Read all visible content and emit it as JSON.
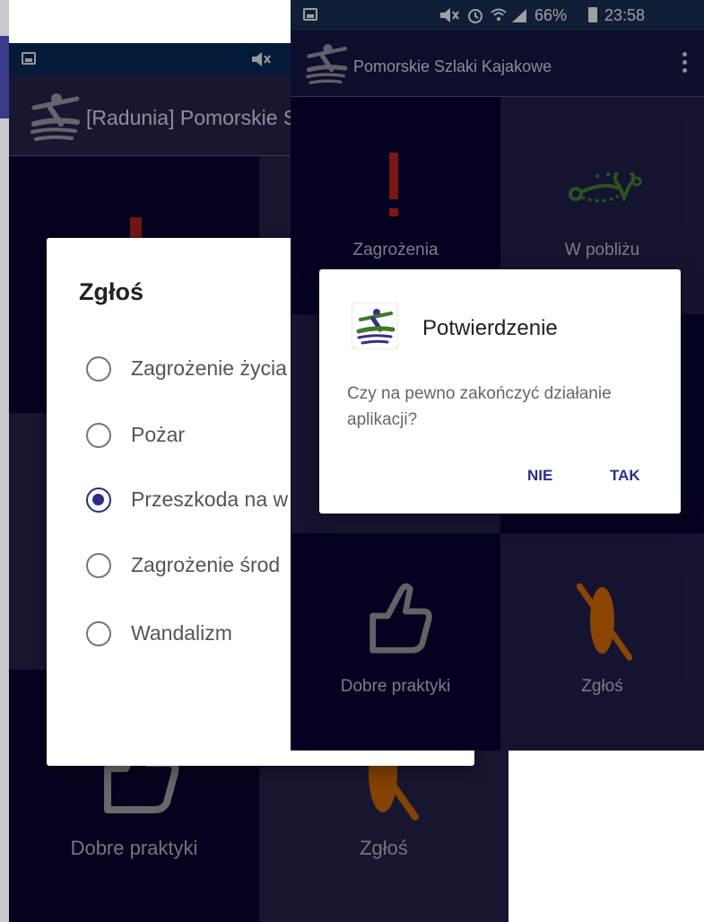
{
  "status_bar": {
    "battery_percent": "66%",
    "time": "23:58"
  },
  "left_screen": {
    "app_title": "[Radunia] Pomorskie S",
    "tiles": {
      "dobre_praktyki": "Dobre praktyki",
      "zglos": "Zgłoś"
    },
    "report_dialog": {
      "title": "Zgłoś",
      "selected_index": 2,
      "options": [
        "Zagrożenie życia",
        "Pożar",
        "Przeszkoda na w",
        "Zagrożenie środ",
        "Wandalizm"
      ]
    }
  },
  "right_screen": {
    "app_title": "Pomorskie Szlaki Kajakowe",
    "tiles": {
      "zagrozenia": "Zagrożenia",
      "w_poblizu": "W pobliżu",
      "dobre_praktyki": "Dobre praktyki",
      "zglos": "Zgłoś"
    },
    "confirm_dialog": {
      "title": "Potwierdzenie",
      "message": "Czy na pewno zakończyć działanie aplikacji?",
      "no_label": "NIE",
      "yes_label": "TAK"
    }
  },
  "colors": {
    "accent": "#2b2c8e",
    "danger_icon": "#b0201a",
    "nearby_icon": "#3c7a2a",
    "kayak_icon": "#c86400"
  },
  "icons": [
    "kayak-logo-icon",
    "exclamation-icon",
    "route-pin-icon",
    "thumbs-up-icon",
    "kayak-crossed-icon",
    "gallery-icon",
    "mute-icon",
    "alarm-icon",
    "wifi-icon",
    "signal-icon",
    "battery-icon",
    "menu-dots-icon"
  ]
}
